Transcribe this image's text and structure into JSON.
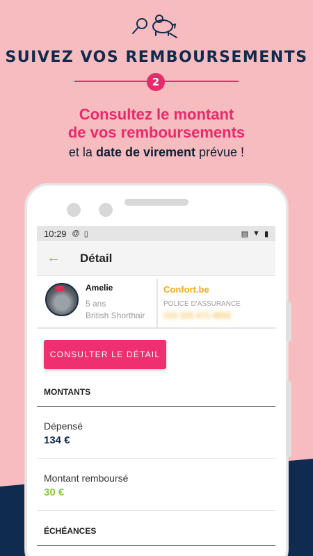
{
  "promo": {
    "icon": "piggy-bank-magnifier-icon",
    "headline": "SUIVEZ VOS REMBOURSEMENTS",
    "step": "2",
    "subtitle_line1": "Consultez le montant",
    "subtitle_line2": "de vos remboursements",
    "caption_prefix": "et la ",
    "caption_bold": "date de virement",
    "caption_suffix": " prévue !",
    "accent": "#e8296a",
    "navy": "#102a4c",
    "background": "#f6bcc0"
  },
  "status_bar": {
    "time": "10:29",
    "icons": [
      "at-icon",
      "sim-icon",
      "vibrate-icon",
      "wifi-icon",
      "battery-icon"
    ]
  },
  "app_bar": {
    "back_icon": "back-arrow-icon",
    "title": "Détail"
  },
  "pet": {
    "name": "Amelie",
    "age": "5 ans",
    "breed": "British Shorthair",
    "insurer": "Confort.be",
    "policy_label": "POLICE D'ASSURANCE",
    "policy_number": "015 326 472 4856"
  },
  "cta_label": "CONSULTER LE DÉTAIL",
  "sections": {
    "amounts_title": "MONTANTS",
    "spent_label": "Dépensé",
    "spent_value": "134 €",
    "reimbursed_label": "Montant remboursé",
    "reimbursed_value": "30 €",
    "schedule_title": "ÉCHÉANCES"
  },
  "colors": {
    "reimbursed": "#8dc63f",
    "insurer": "#f2a91c",
    "cta": "#ef2f6f"
  }
}
